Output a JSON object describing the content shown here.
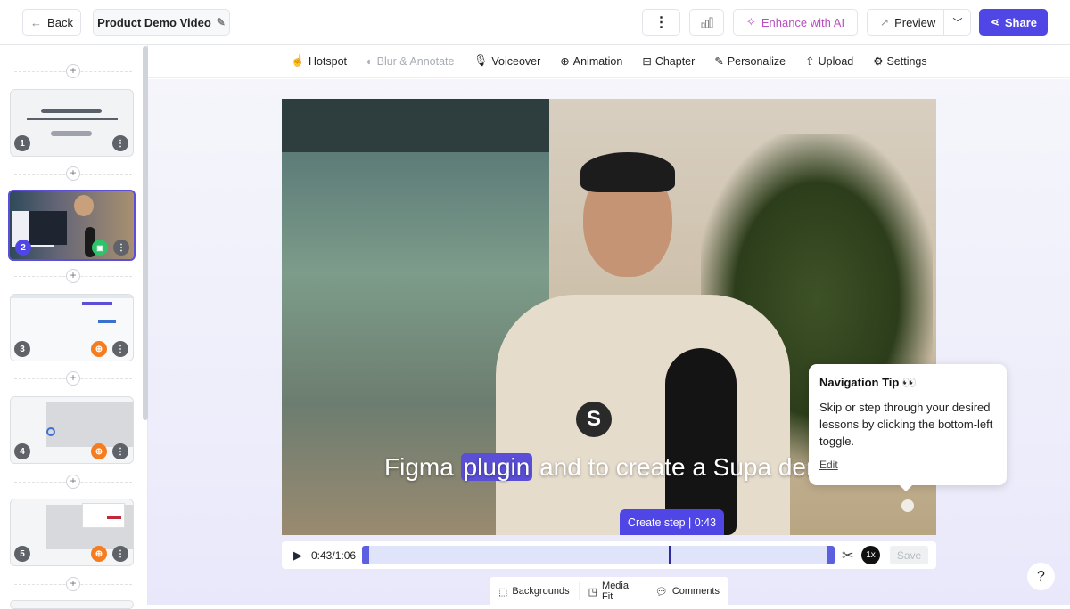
{
  "topbar": {
    "back_label": "Back",
    "title": "Product Demo Video",
    "more_icon": "vertical-dots-icon",
    "analytics_icon": "bar-chart-icon",
    "enhance_label": "Enhance with AI",
    "preview_label": "Preview",
    "share_label": "Share",
    "accent": "#4f46e5",
    "enhance_color": "#b84fc0"
  },
  "toolbar": {
    "items": [
      {
        "label": "Hotspot",
        "icon": "pointer-icon",
        "disabled": false
      },
      {
        "label": "Blur & Annotate",
        "icon": "blur-icon",
        "disabled": true
      },
      {
        "label": "Voiceover",
        "icon": "mic-icon",
        "disabled": false
      },
      {
        "label": "Animation",
        "icon": "zoom-icon",
        "disabled": false
      },
      {
        "label": "Chapter",
        "icon": "chapter-icon",
        "disabled": false
      },
      {
        "label": "Personalize",
        "icon": "pen-icon",
        "disabled": false
      },
      {
        "label": "Upload",
        "icon": "upload-icon",
        "disabled": false
      },
      {
        "label": "Settings",
        "icon": "gear-icon",
        "disabled": false
      }
    ]
  },
  "sidebar": {
    "steps": [
      {
        "number": "1",
        "type": "title-card"
      },
      {
        "number": "2",
        "type": "video",
        "selected": true
      },
      {
        "number": "3",
        "type": "screen"
      },
      {
        "number": "4",
        "type": "screen"
      },
      {
        "number": "5",
        "type": "screen"
      }
    ]
  },
  "video": {
    "caption_before": "Figma",
    "caption_highlight": "plugin",
    "caption_after": "and to create a Supa den",
    "create_step_label": "Create step | 0:43"
  },
  "popup": {
    "title": "Navigation Tip 👀",
    "body": "Skip or step through your desired lessons by clicking the bottom-left toggle.",
    "edit_label": "Edit"
  },
  "player": {
    "current_time": "0:43",
    "duration": "1:06",
    "progress_fraction": 0.65,
    "speed_label": "1x",
    "save_label": "Save"
  },
  "bottom_bar": {
    "backgrounds_label": "Backgrounds",
    "media_fit_label": "Media Fit",
    "comments_label": "Comments"
  },
  "help_label": "?"
}
